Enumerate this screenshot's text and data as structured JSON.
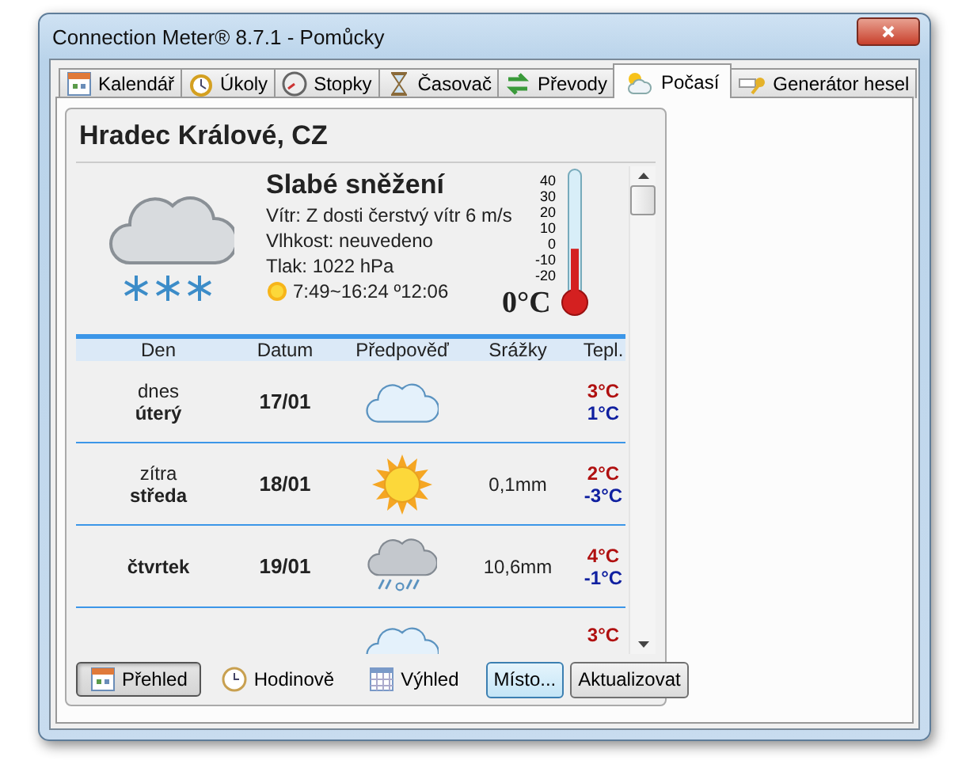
{
  "window": {
    "title": "Connection Meter® 8.7.1 - Pomůcky"
  },
  "tabs": [
    {
      "label": "Kalendář",
      "kind": "calendar",
      "selected": false
    },
    {
      "label": "Úkoly",
      "kind": "alarm",
      "selected": false
    },
    {
      "label": "Stopky",
      "kind": "stopwatch",
      "selected": false
    },
    {
      "label": "Časovač",
      "kind": "hourglass",
      "selected": false
    },
    {
      "label": "Převody",
      "kind": "arrows",
      "selected": false
    },
    {
      "label": "Počasí",
      "kind": "weather",
      "selected": true
    },
    {
      "label": "Generátor hesel",
      "kind": "key",
      "selected": false
    }
  ],
  "location": "Hradec Králové, CZ",
  "current": {
    "condition": "Slabé sněžení",
    "wind": "Vítr: Z dosti čerstvý vítr 6 m/s",
    "humidity": "Vlhkost: neuvedeno",
    "pressure": "Tlak: 1022 hPa",
    "sun": "7:49~16:24 º12:06",
    "temperature": "0°C",
    "thermometer": {
      "ticks": [
        "40",
        "30",
        "20",
        "10",
        "0",
        "-10",
        "-20"
      ],
      "level": 0.37
    }
  },
  "table": {
    "columns": [
      "Den",
      "Datum",
      "Předpověď",
      "Srážky",
      "Tepl."
    ],
    "rows": [
      {
        "day_label": "dnes",
        "day": "úterý",
        "date": "17/01",
        "kind": "cloud",
        "precipitation": "",
        "high": "3°C",
        "low": "1°C"
      },
      {
        "day_label": "zítra",
        "day": "středa",
        "date": "18/01",
        "kind": "sun",
        "precipitation": "0,1mm",
        "high": "2°C",
        "low": "-3°C"
      },
      {
        "day_label": "",
        "day": "čtvrtek",
        "date": "19/01",
        "kind": "sleet",
        "precipitation": "10,6mm",
        "high": "4°C",
        "low": "-1°C"
      },
      {
        "day_label": "",
        "day": "",
        "date": "",
        "kind": "cloud",
        "precipitation": "",
        "high": "3°C",
        "low": ""
      }
    ]
  },
  "views": [
    {
      "label": "Přehled",
      "kind": "calendar",
      "selected": true
    },
    {
      "label": "Hodinově",
      "kind": "clock",
      "selected": false
    },
    {
      "label": "Výhled",
      "kind": "grid",
      "selected": false
    }
  ],
  "buttons": [
    {
      "label": "Místo...",
      "focused": true
    },
    {
      "label": "Aktualizovat",
      "focused": false
    }
  ]
}
